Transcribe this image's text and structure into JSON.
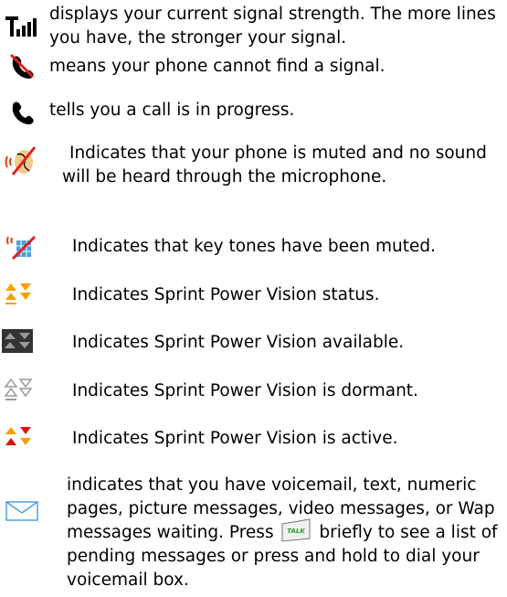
{
  "rows": [
    {
      "icon": "signal-strength-icon",
      "text": "displays your current signal strength. The more lines you have, the stronger your signal."
    },
    {
      "icon": "no-signal-icon",
      "text": "means your phone cannot find a signal."
    },
    {
      "icon": "call-in-progress-icon",
      "text": "tells you a call is in progress."
    },
    {
      "icon": "microphone-muted-icon",
      "text": "Indicates that your phone is muted and no sound will be heard through the microphone."
    },
    {
      "icon": "key-tones-muted-icon",
      "text": "Indicates that key tones have been muted."
    },
    {
      "icon": "power-vision-status-icon",
      "text": "Indicates Sprint Power Vision status."
    },
    {
      "icon": "power-vision-available-icon",
      "text": "Indicates Sprint Power Vision available."
    },
    {
      "icon": "power-vision-dormant-icon",
      "text": "Indicates Sprint Power Vision is dormant."
    },
    {
      "icon": "power-vision-active-icon",
      "text": "Indicates Sprint Power Vision is active."
    },
    {
      "icon": "message-envelope-icon",
      "text_before": "indicates that you have voicemail, text, numeric pages, picture messages, video messages, or Wap messages waiting. Press",
      "key_label": "TALK",
      "text_after": "briefly to see a list of pending messages or press and hold to dial your voicemail box."
    }
  ],
  "colors": {
    "icon_black": "#000000",
    "no_signal_slash": "#e02020",
    "power_orange": "#f5a000",
    "power_red": "#e01010",
    "power_gray": "#9a9a9a",
    "power_dark_bg": "#333333",
    "envelope_blue": "#4aa0e0",
    "talk_key_green": "#2aa02a"
  }
}
